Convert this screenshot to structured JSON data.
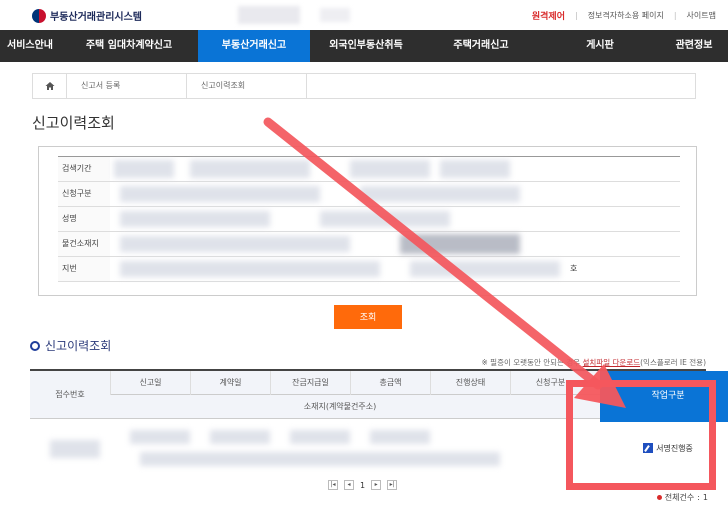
{
  "header": {
    "logo_text": "부동산거래관리시스템",
    "links": [
      "원격제어",
      "정보격자하소용 페이지",
      "사이트맵"
    ]
  },
  "nav": {
    "items": [
      "서비스안내",
      "주택 임대차계약신고",
      "부동산거래신고",
      "외국인부동산취득",
      "주택거래신고",
      "게시판",
      "관련정보"
    ],
    "active_index": 2
  },
  "breadcrumb": [
    "신고서 등록",
    "신고이력조회"
  ],
  "page_title": "신고이력조회",
  "search": {
    "labels": [
      "검색기간",
      "신청구분",
      "성명",
      "물건소재지",
      "지번"
    ],
    "trailing_text": "호"
  },
  "query_button": "조회",
  "section_title": "신고이력조회",
  "notice": {
    "prefix": "※ 필증이 오랫동안 안되는 경우 ",
    "link": "설치파일 다운로드",
    "suffix": "(익스플로러 IE 전용)"
  },
  "table": {
    "headers_row1": [
      "접수번호",
      "신고일",
      "계약일",
      "잔금지급일",
      "총금액",
      "진행상태",
      "신청구분"
    ],
    "header_row2": "소재지(계약물건주소)",
    "work_header": "작업구분",
    "work_cell": "서명진행중"
  },
  "pagination": {
    "current": "1"
  },
  "total": {
    "label": "전체건수",
    "value": "1"
  },
  "colors": {
    "nav_active": "#0a74d6",
    "query_button": "#ff6a0b",
    "highlight": "#f4575d"
  }
}
